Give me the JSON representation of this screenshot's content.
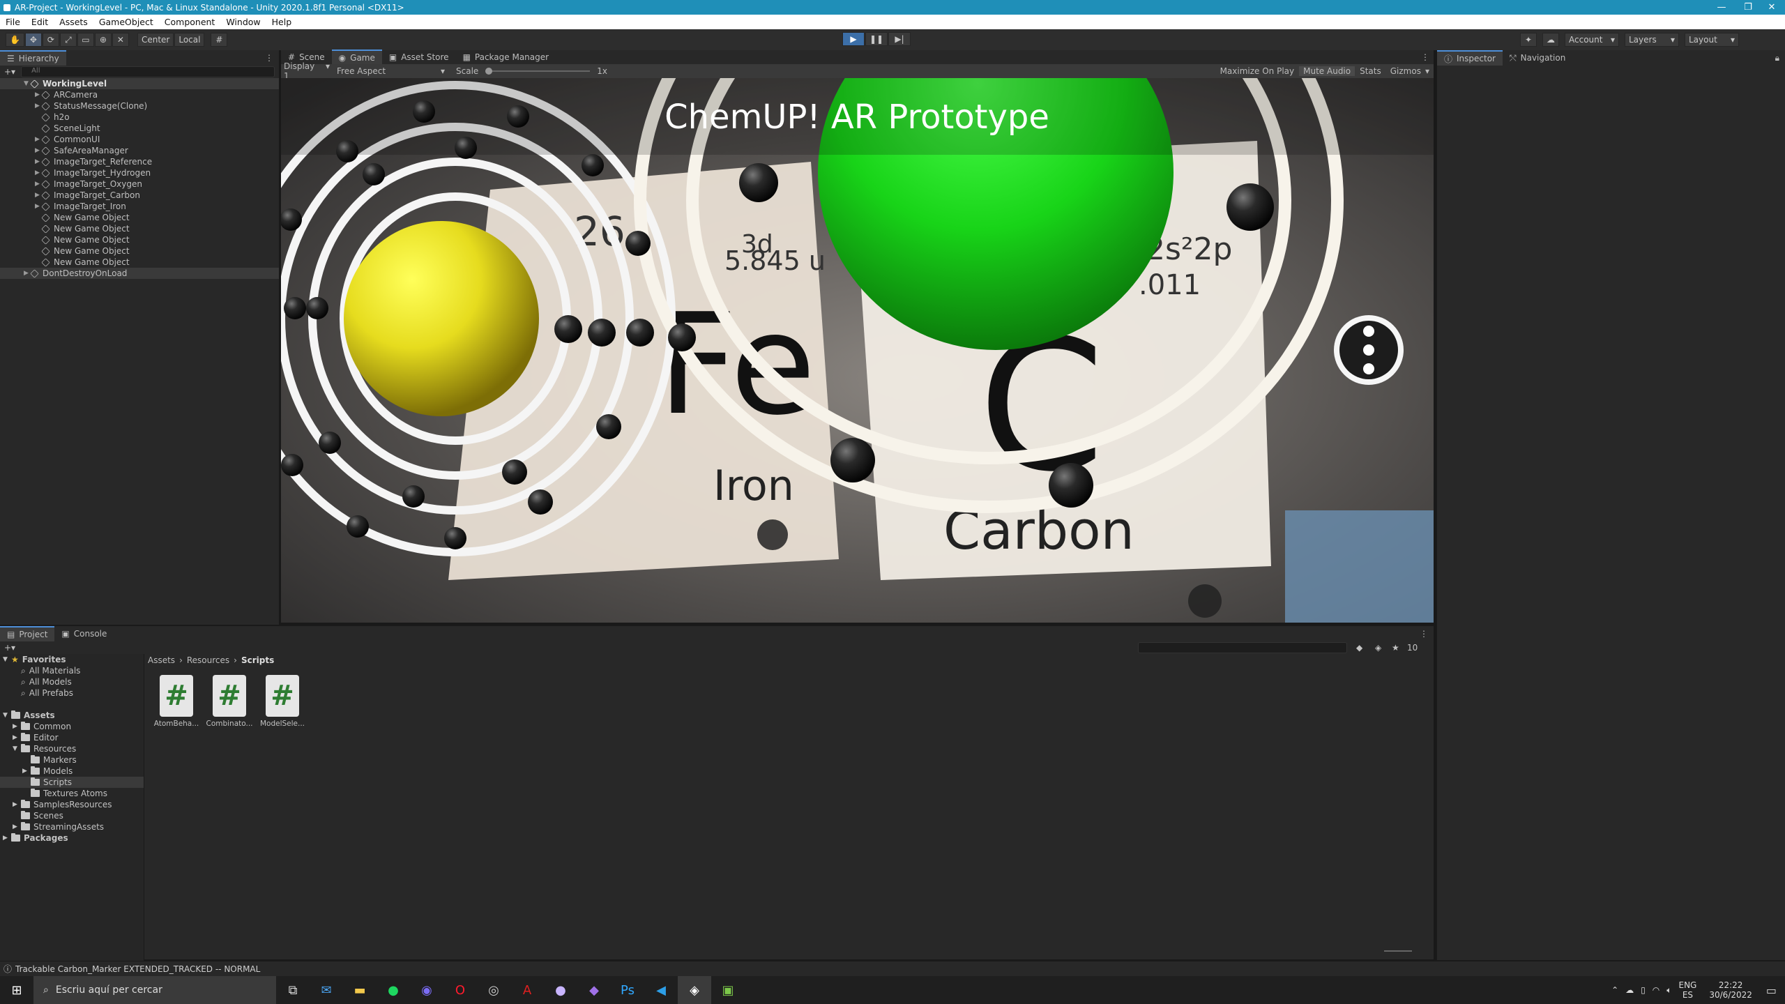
{
  "window": {
    "title": "AR-Project - WorkingLevel - PC, Mac & Linux Standalone - Unity 2020.1.8f1 Personal <DX11>"
  },
  "menu": [
    "File",
    "Edit",
    "Assets",
    "GameObject",
    "Component",
    "Window",
    "Help"
  ],
  "toolbar": {
    "center": "Center",
    "local": "Local",
    "account": "Account",
    "layers": "Layers",
    "layout": "Layout"
  },
  "hierarchy": {
    "tab": "Hierarchy",
    "search_placeholder": "All",
    "scene": "WorkingLevel",
    "items": [
      "ARCamera",
      "StatusMessage(Clone)",
      "h2o",
      "SceneLight",
      "CommonUI",
      "SafeAreaManager",
      "ImageTarget_Reference",
      "ImageTarget_Hydrogen",
      "ImageTarget_Oxygen",
      "ImageTarget_Carbon",
      "ImageTarget_Iron",
      "New Game Object",
      "New Game Object",
      "New Game Object",
      "New Game Object",
      "New Game Object"
    ],
    "ddol": "DontDestroyOnLoad"
  },
  "scene_tabs": [
    "Scene",
    "Game",
    "Asset Store",
    "Package Manager"
  ],
  "game_bar": {
    "display": "Display 1",
    "aspect": "Free Aspect",
    "scale_label": "Scale",
    "scale_value": "1x",
    "maximize": "Maximize On Play",
    "mute": "Mute Audio",
    "stats": "Stats",
    "gizmos": "Gizmos"
  },
  "game": {
    "title": "ChemUP! AR Prototype",
    "label_iron": "Iron",
    "label_carbon": "Carbon",
    "symbol_fe": "Fe",
    "symbol_c": "C",
    "fe_config": "3d",
    "fe_mass": "5.845 u",
    "c_config": "2s²2p",
    "c_mass": ".011",
    "fe_number": "26"
  },
  "inspector": {
    "tab": "Inspector",
    "nav": "Navigation"
  },
  "project": {
    "tab": "Project",
    "console": "Console",
    "favorites": "Favorites",
    "fav_items": [
      "All Materials",
      "All Models",
      "All Prefabs"
    ],
    "assets": "Assets",
    "asset_folders": [
      "Common",
      "Editor",
      "Resources",
      "Markers",
      "Models",
      "Scripts",
      "Textures Atoms",
      "SamplesResources",
      "Scenes",
      "StreamingAssets"
    ],
    "packages": "Packages",
    "breadcrumb": [
      "Assets",
      "Resources",
      "Scripts"
    ],
    "hidden_count": "10",
    "files": [
      "AtomBeha...",
      "Combinato...",
      "ModelSele..."
    ],
    "file_symbol": "#"
  },
  "status": {
    "message": "Trackable Carbon_Marker EXTENDED_TRACKED -- NORMAL"
  },
  "taskbar": {
    "search_placeholder": "Escriu aquí per cercar",
    "lang_top": "ENG",
    "lang_bottom": "ES",
    "time": "22:22",
    "date": "30/6/2022"
  }
}
